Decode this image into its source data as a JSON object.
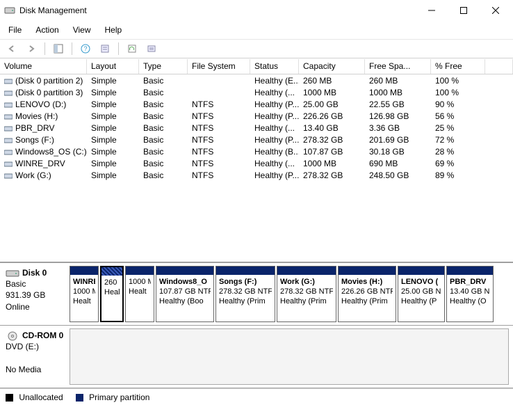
{
  "window": {
    "title": "Disk Management"
  },
  "menu": [
    "File",
    "Action",
    "View",
    "Help"
  ],
  "toolbar_icons": [
    "back-icon",
    "forward-icon",
    "sep",
    "show-hide-console-tree-icon",
    "sep",
    "help-icon",
    "properties-icon",
    "sep",
    "refresh-icon",
    "action-list-icon"
  ],
  "columns": [
    "Volume",
    "Layout",
    "Type",
    "File System",
    "Status",
    "Capacity",
    "Free Spa...",
    "% Free"
  ],
  "volumes": [
    {
      "icon": "drive",
      "name": "(Disk 0 partition 2)",
      "layout": "Simple",
      "type": "Basic",
      "fs": "",
      "status": "Healthy (E...",
      "capacity": "260 MB",
      "free": "260 MB",
      "pct": "100 %"
    },
    {
      "icon": "drive",
      "name": "(Disk 0 partition 3)",
      "layout": "Simple",
      "type": "Basic",
      "fs": "",
      "status": "Healthy (...",
      "capacity": "1000 MB",
      "free": "1000 MB",
      "pct": "100 %"
    },
    {
      "icon": "drive",
      "name": "LENOVO (D:)",
      "layout": "Simple",
      "type": "Basic",
      "fs": "NTFS",
      "status": "Healthy (P...",
      "capacity": "25.00 GB",
      "free": "22.55 GB",
      "pct": "90 %"
    },
    {
      "icon": "drive",
      "name": "Movies (H:)",
      "layout": "Simple",
      "type": "Basic",
      "fs": "NTFS",
      "status": "Healthy (P...",
      "capacity": "226.26 GB",
      "free": "126.98 GB",
      "pct": "56 %"
    },
    {
      "icon": "drive",
      "name": "PBR_DRV",
      "layout": "Simple",
      "type": "Basic",
      "fs": "NTFS",
      "status": "Healthy (...",
      "capacity": "13.40 GB",
      "free": "3.36 GB",
      "pct": "25 %"
    },
    {
      "icon": "drive",
      "name": "Songs (F:)",
      "layout": "Simple",
      "type": "Basic",
      "fs": "NTFS",
      "status": "Healthy (P...",
      "capacity": "278.32 GB",
      "free": "201.69 GB",
      "pct": "72 %"
    },
    {
      "icon": "drive",
      "name": "Windows8_OS (C:)",
      "layout": "Simple",
      "type": "Basic",
      "fs": "NTFS",
      "status": "Healthy (B...",
      "capacity": "107.87 GB",
      "free": "30.18 GB",
      "pct": "28 %"
    },
    {
      "icon": "drive",
      "name": "WINRE_DRV",
      "layout": "Simple",
      "type": "Basic",
      "fs": "NTFS",
      "status": "Healthy (...",
      "capacity": "1000 MB",
      "free": "690 MB",
      "pct": "69 %"
    },
    {
      "icon": "drive",
      "name": "Work (G:)",
      "layout": "Simple",
      "type": "Basic",
      "fs": "NTFS",
      "status": "Healthy (P...",
      "capacity": "278.32 GB",
      "free": "248.50 GB",
      "pct": "89 %"
    }
  ],
  "disk0": {
    "title": "Disk 0",
    "type": "Basic",
    "size": "931.39 GB",
    "status": "Online",
    "parts": [
      {
        "name": "WINRE",
        "size": "1000 M",
        "status": "Healt",
        "w": 42,
        "selected": false
      },
      {
        "name": "",
        "size": "260 M",
        "status": "Heal",
        "w": 34,
        "selected": true
      },
      {
        "name": "",
        "size": "1000 M",
        "status": "Healt",
        "w": 42,
        "selected": false
      },
      {
        "name": "Windows8_O",
        "size": "107.87 GB NTF",
        "status": "Healthy (Boo",
        "w": 84,
        "selected": false
      },
      {
        "name": "Songs  (F:)",
        "size": "278.32 GB NTF",
        "status": "Healthy (Prim",
        "w": 86,
        "selected": false
      },
      {
        "name": "Work  (G:)",
        "size": "278.32 GB NTF",
        "status": "Healthy (Prim",
        "w": 86,
        "selected": false
      },
      {
        "name": "Movies  (H:)",
        "size": "226.26 GB NTF",
        "status": "Healthy (Prim",
        "w": 84,
        "selected": false
      },
      {
        "name": "LENOVO (",
        "size": "25.00 GB N",
        "status": "Healthy (P",
        "w": 68,
        "selected": false
      },
      {
        "name": "PBR_DRV",
        "size": "13.40 GB N",
        "status": "Healthy (O",
        "w": 68,
        "selected": false
      }
    ]
  },
  "cdrom": {
    "title": "CD-ROM 0",
    "line2": "DVD (E:)",
    "line3": "No Media"
  },
  "legend": {
    "unalloc": "Unallocated",
    "primary": "Primary partition"
  },
  "colors": {
    "primary_partition": "#0a246a",
    "unallocated": "#000000"
  }
}
